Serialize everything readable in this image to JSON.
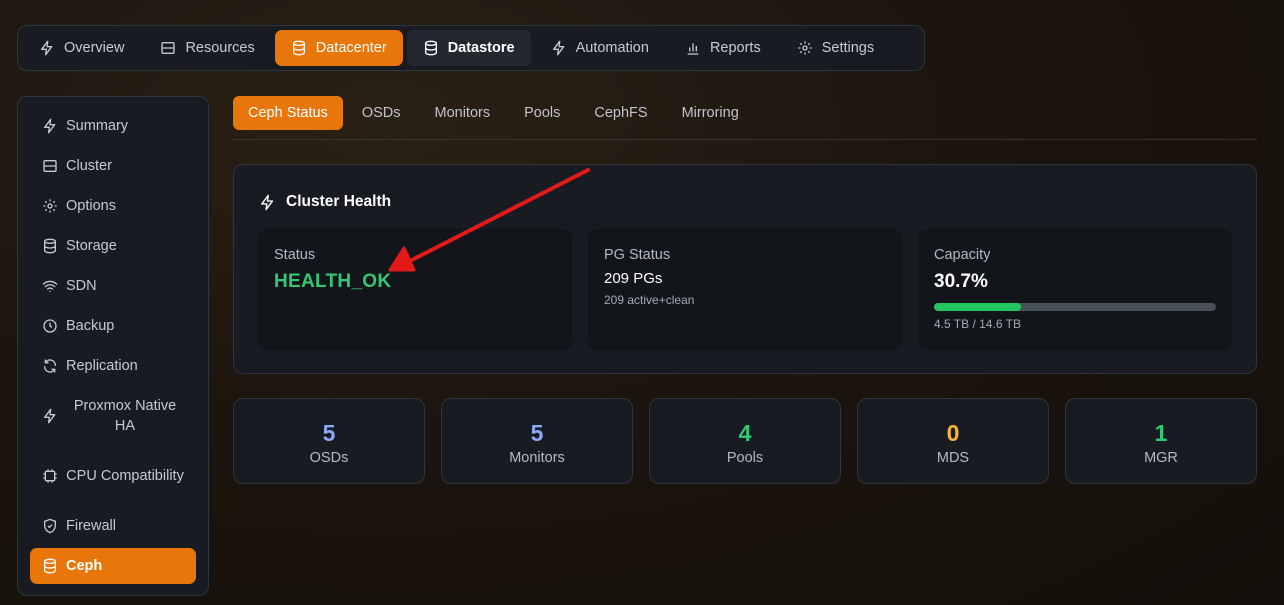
{
  "topnav": [
    {
      "label": "Overview",
      "icon": "bolt-icon"
    },
    {
      "label": "Resources",
      "icon": "server-icon"
    },
    {
      "label": "Datacenter",
      "icon": "database-icon"
    },
    {
      "label": "Datastore",
      "icon": "database-icon"
    },
    {
      "label": "Automation",
      "icon": "bolt-icon"
    },
    {
      "label": "Reports",
      "icon": "bar-chart-icon"
    },
    {
      "label": "Settings",
      "icon": "gear-icon"
    }
  ],
  "sidebar": [
    {
      "label": "Summary",
      "icon": "bolt-icon"
    },
    {
      "label": "Cluster",
      "icon": "server-icon"
    },
    {
      "label": "Options",
      "icon": "gear-icon"
    },
    {
      "label": "Storage",
      "icon": "database-icon"
    },
    {
      "label": "SDN",
      "icon": "wifi-icon"
    },
    {
      "label": "Backup",
      "icon": "clock-icon"
    },
    {
      "label": "Replication",
      "icon": "refresh-icon"
    },
    {
      "label": "Proxmox Native HA",
      "icon": "bolt-icon"
    },
    {
      "label": "CPU Compatibility",
      "icon": "cpu-icon"
    },
    {
      "label": "Firewall",
      "icon": "shield-icon"
    },
    {
      "label": "Ceph",
      "icon": "database-icon"
    }
  ],
  "subtabs": [
    "Ceph Status",
    "OSDs",
    "Monitors",
    "Pools",
    "CephFS",
    "Mirroring"
  ],
  "health": {
    "title": "Cluster Health",
    "status": {
      "label": "Status",
      "value": "HEALTH_OK"
    },
    "pg": {
      "label": "PG Status",
      "value": "209 PGs",
      "detail": "209 active+clean"
    },
    "capacity": {
      "label": "Capacity",
      "value": "30.7%",
      "percent": 30.7,
      "detail": "4.5 TB / 14.6 TB"
    }
  },
  "stats": [
    {
      "value": "5",
      "label": "OSDs",
      "color": "#8ea8f5"
    },
    {
      "value": "5",
      "label": "Monitors",
      "color": "#8ea8f5"
    },
    {
      "value": "4",
      "label": "Pools",
      "color": "#34c773"
    },
    {
      "value": "0",
      "label": "MDS",
      "color": "#f5b52e"
    },
    {
      "value": "1",
      "label": "MGR",
      "color": "#34c773"
    }
  ],
  "colors": {
    "accent": "#e8760a",
    "ok": "#34c773",
    "annotation": "#e21a1a"
  }
}
